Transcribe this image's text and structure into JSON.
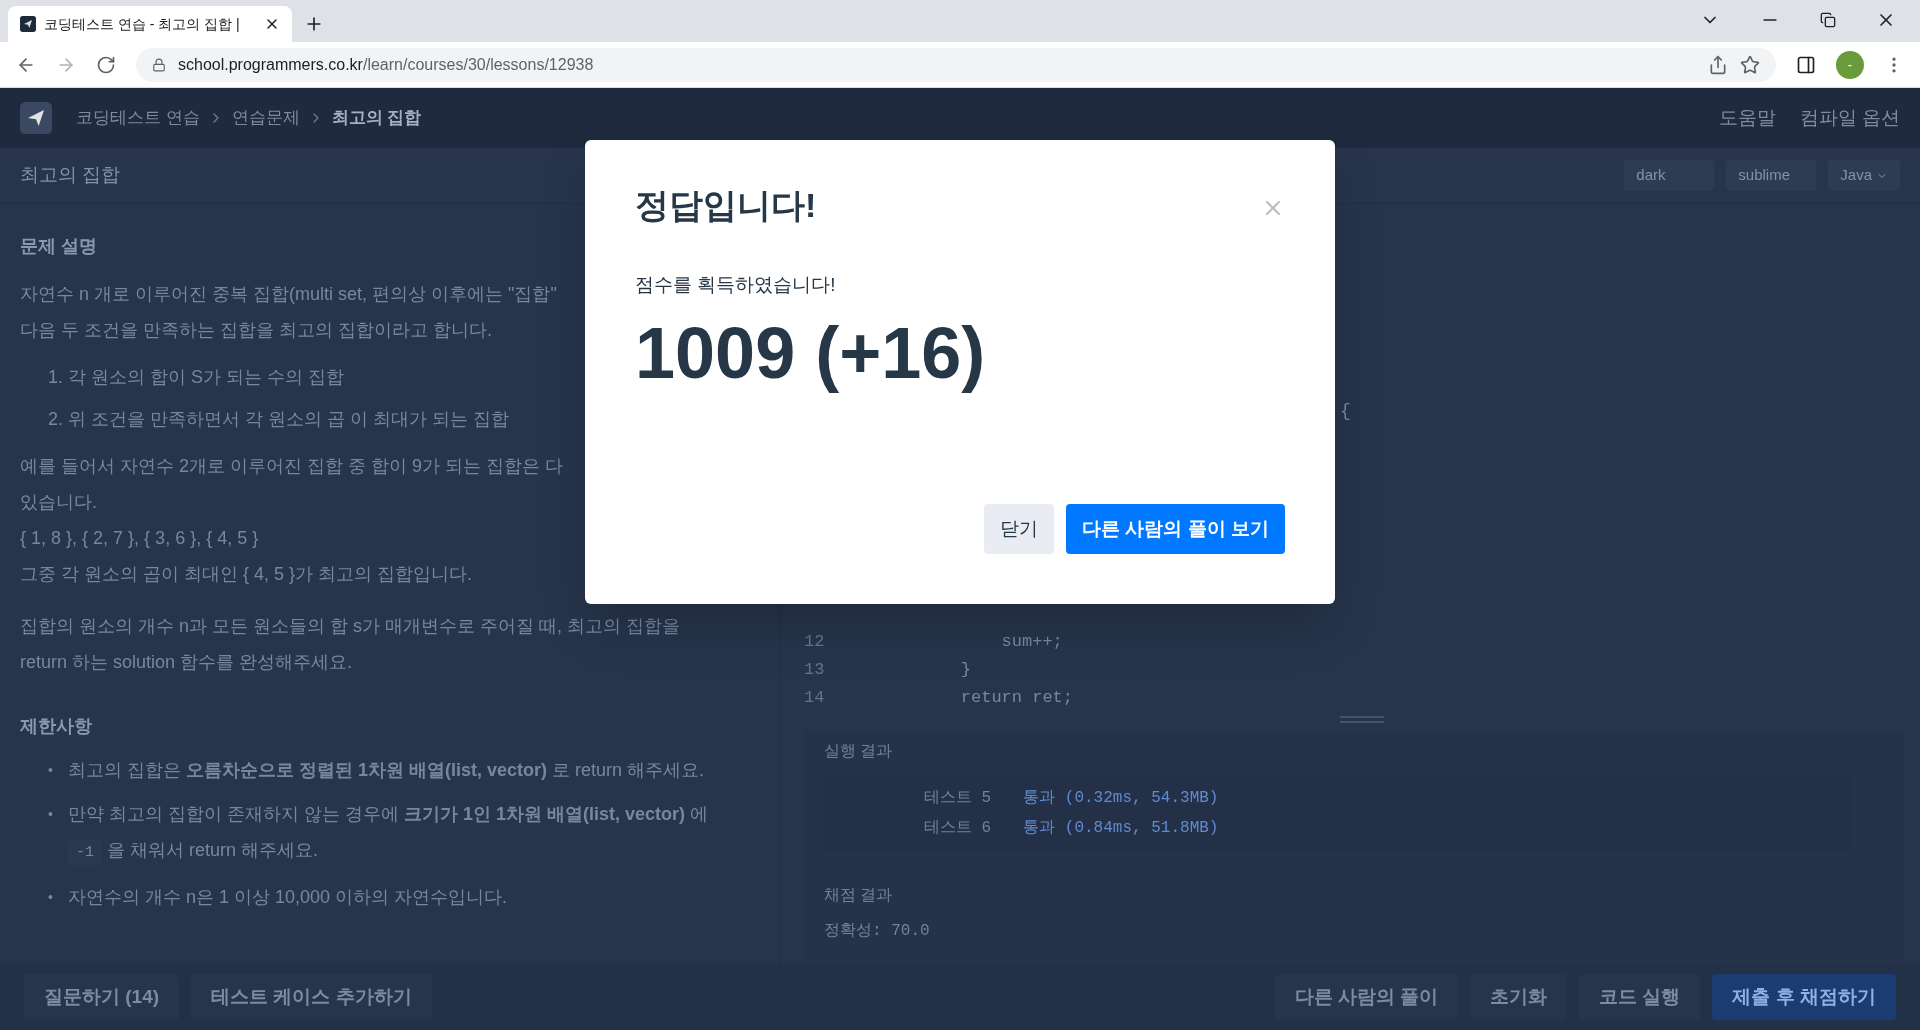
{
  "browser": {
    "tab_title": "코딩테스트 연습 - 최고의 집합 |",
    "url_host": "school.programmers.co.kr",
    "url_path": "/learn/courses/30/lessons/12938",
    "profile": "-"
  },
  "header": {
    "breadcrumbs": [
      {
        "label": "코딩테스트 연습",
        "current": false
      },
      {
        "label": "연습문제",
        "current": false
      },
      {
        "label": "최고의 집합",
        "current": true
      }
    ],
    "links": [
      "도움말",
      "컴파일 옵션"
    ]
  },
  "title": "최고의 집합",
  "editor_options": [
    "dark",
    "sublime"
  ],
  "language": "Java",
  "problem": {
    "heading": "문제 설명",
    "intro": [
      "자연수 n 개로 이루어진 중복 집합(multi set, 편의상 이후에는 \"집합\"",
      "다음 두 조건을 만족하는 집합을 최고의 집합이라고 합니다."
    ],
    "conditions": [
      "1. 각 원소의 합이 S가 되는 수의 집합",
      "2. 위 조건을 만족하면서 각 원소의 곱 이 최대가 되는 집합"
    ],
    "example": [
      "예를 들어서 자연수 2개로 이루어진 집합 중 합이 9가 되는 집합은 다",
      "있습니다.",
      "{ 1, 8 }, { 2, 7 }, { 3, 6 }, { 4, 5 }",
      "그중 각 원소의 곱이 최대인 { 4, 5 }가 최고의 집합입니다."
    ],
    "task": "집합의 원소의 개수 n과 모든 원소들의 합 s가 매개변수로 주어질 때, 최고의 집합을 return 하는 solution 함수를 완성해주세요.",
    "limits_heading": "제한사항",
    "marker": "•",
    "limits": [
      {
        "kind": "text",
        "text": "최고의 집합은 **오름차순으로 정렬된 1차원 배열(list, vector)** 로 return 해주세요."
      },
      {
        "kind": "code",
        "before": "만약 최고의 집합이 존재하지 않는 경우에 **크기가 1인 1차원 배열(list, vector)** 에",
        "code": "-1",
        "after": "을 채워서 return 해주세요."
      },
      {
        "kind": "text",
        "text": "자연수의 개수 n은 1 이상 10,000 이하의 자연수입니다."
      }
    ]
  },
  "code": {
    "fragment": "{",
    "lines": [
      {
        "number": "12",
        "text": "        sum++;"
      },
      {
        "number": "13",
        "text": "    }"
      },
      {
        "number": "14",
        "text": "    return ret;"
      }
    ]
  },
  "results": {
    "heading": "실행 결과",
    "rows": [
      {
        "name": "테스트 5",
        "status": "통과",
        "detail": "(0.32ms, 54.3MB)"
      },
      {
        "name": "테스트 6",
        "status": "통과",
        "detail": "(0.84ms, 51.8MB)"
      }
    ],
    "grading_heading": "채점 결과",
    "grading": "정확성: 70.0"
  },
  "footer": {
    "left": [
      "질문하기 (14)",
      "테스트 케이스 추가하기"
    ],
    "right": [
      {
        "label": "다른 사람의 풀이",
        "primary": false
      },
      {
        "label": "초기화",
        "primary": false
      },
      {
        "label": "코드 실행",
        "primary": false
      },
      {
        "label": "제출 후 채점하기",
        "primary": true
      }
    ]
  },
  "modal": {
    "title": "정답입니다!",
    "message": "점수를 획득하였습니다!",
    "score": "1009 (+16)",
    "buttons": [
      {
        "label": "닫기",
        "primary": false
      },
      {
        "label": "다른 사람의 풀이 보기",
        "primary": true
      }
    ]
  }
}
